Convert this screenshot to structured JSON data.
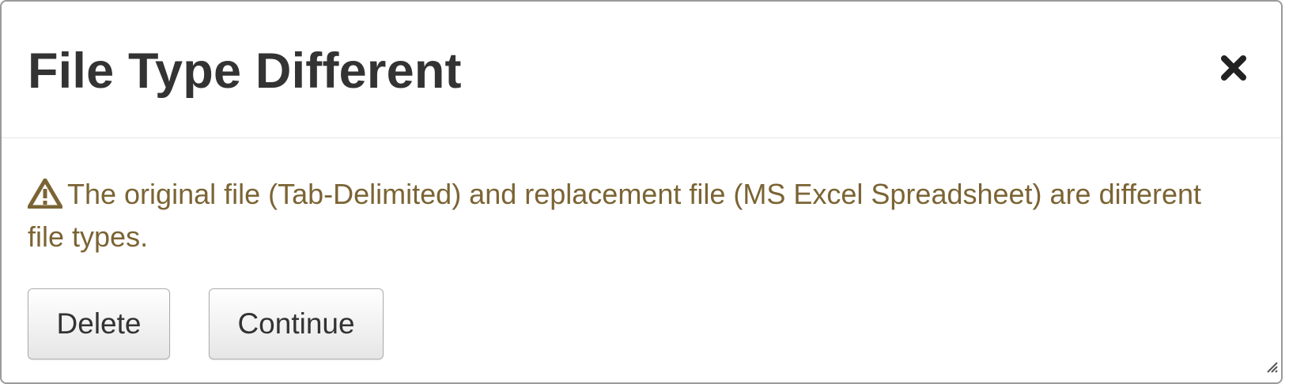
{
  "dialog": {
    "title": "File Type Different",
    "close_icon": "close-icon",
    "warning_icon": "warning-triangle-icon",
    "message": "The original file (Tab-Delimited) and replacement file (MS Excel Spreadsheet) are different file types.",
    "buttons": {
      "delete_label": "Delete",
      "continue_label": "Continue"
    },
    "colors": {
      "title": "#333333",
      "message": "#7b6434",
      "border": "#9a9a9a"
    }
  }
}
